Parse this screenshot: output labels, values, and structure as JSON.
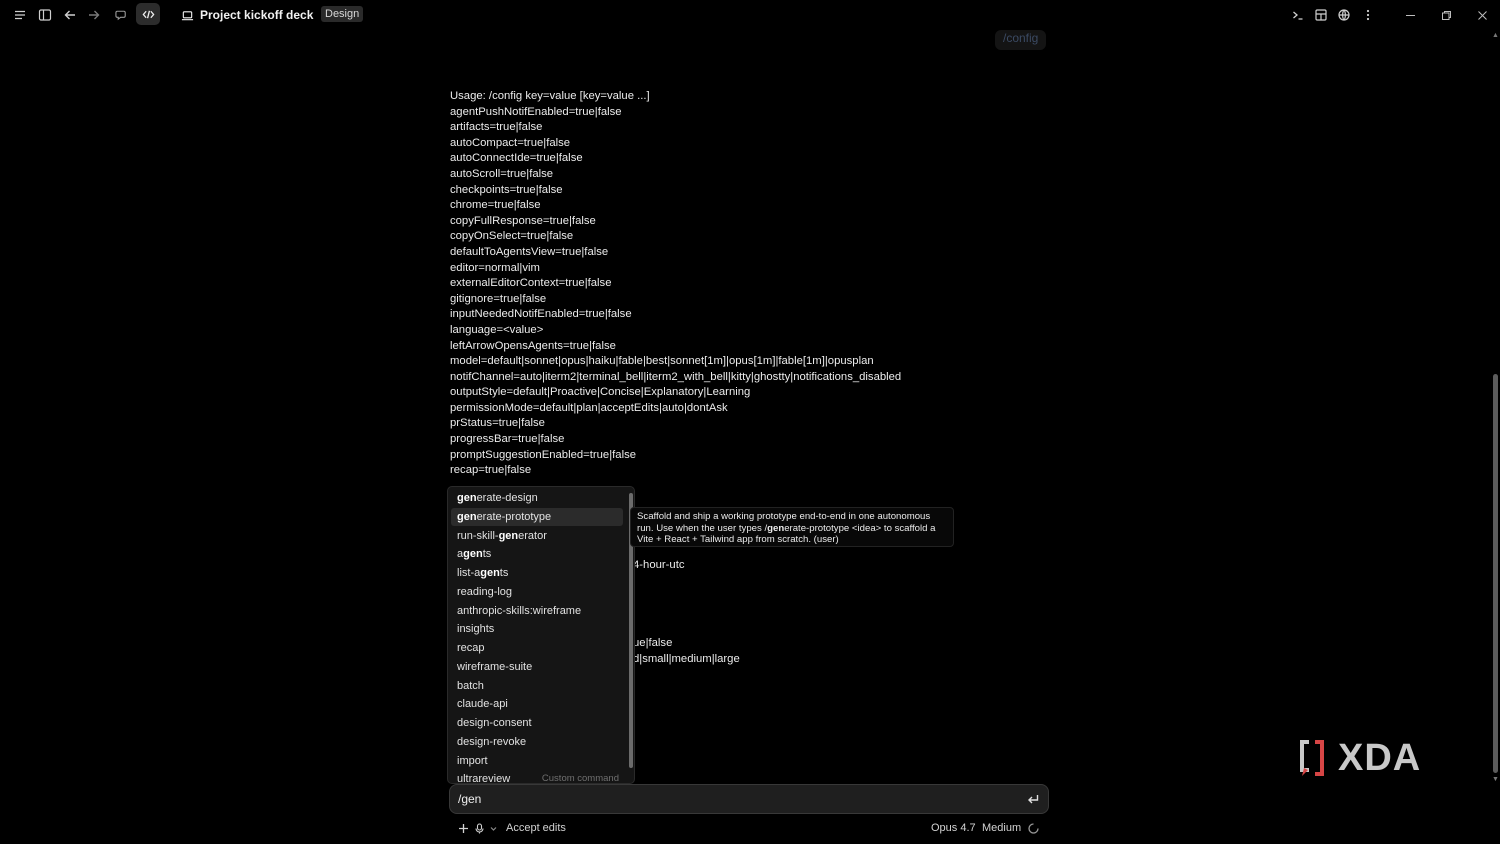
{
  "topbar": {
    "project_title": "Project kickoff deck",
    "badge": "Design"
  },
  "history": {
    "user_command": "/config"
  },
  "output": {
    "lines": [
      "Usage: /config key=value [key=value ...]",
      "agentPushNotifEnabled=true|false",
      "artifacts=true|false",
      "autoCompact=true|false",
      "autoConnectIde=true|false",
      "autoScroll=true|false",
      "checkpoints=true|false",
      "chrome=true|false",
      "copyFullResponse=true|false",
      "copyOnSelect=true|false",
      "defaultToAgentsView=true|false",
      "editor=normal|vim",
      "externalEditorContext=true|false",
      "gitignore=true|false",
      "inputNeededNotifEnabled=true|false",
      "language=<value>",
      "leftArrowOpensAgents=true|false",
      "model=default|sonnet|opus|haiku|fable|best|sonnet[1m]|opus[1m]|fable[1m]|opusplan",
      "notifChannel=auto|iterm2|terminal_bell|iterm2_with_bell|kitty|ghostty|notifications_disabled",
      "outputStyle=default|Proactive|Concise|Explanatory|Learning",
      "permissionMode=default|plan|acceptEdits|auto|dontAsk",
      "prStatus=true|false",
      "progressBar=true|false",
      "promptSuggestionEnabled=true|false",
      "recap=true|false"
    ],
    "hidden_fragments": [
      "4-hour-utc",
      "ue|false",
      "d|small|medium|large"
    ]
  },
  "autocomplete": {
    "items": [
      {
        "match": "gen",
        "rest": "erate-design",
        "selected": false
      },
      {
        "match": "gen",
        "rest": "erate-prototype",
        "selected": true
      },
      {
        "pre": "run-skill-",
        "match": "gen",
        "rest": "erator",
        "selected": false
      },
      {
        "pre": "a",
        "match": "gen",
        "rest": "ts",
        "selected": false
      },
      {
        "pre": "list-a",
        "match": "gen",
        "rest": "ts",
        "selected": false
      },
      {
        "pre": "reading-log",
        "selected": false
      },
      {
        "pre": "anthropic-skills:wireframe",
        "selected": false
      },
      {
        "pre": "insights",
        "selected": false
      },
      {
        "pre": "recap",
        "selected": false
      },
      {
        "pre": "wireframe-suite",
        "selected": false
      },
      {
        "pre": "batch",
        "selected": false
      },
      {
        "pre": "claude-api",
        "selected": false
      },
      {
        "pre": "design-consent",
        "selected": false
      },
      {
        "pre": "design-revoke",
        "selected": false
      },
      {
        "pre": "import",
        "selected": false
      },
      {
        "pre": "ultrareview",
        "selected": false,
        "tag": "Custom command"
      }
    ]
  },
  "tooltip": {
    "text_before": "Scaffold and ship a working prototype end-to-end in one autonomous run. Use when the user types /",
    "text_bold": "gen",
    "text_after": "erate-prototype <idea> to scaffold a Vite + React + Tailwind app from scratch. (user)"
  },
  "input": {
    "value": "/gen"
  },
  "toolbar": {
    "accept_edits": "Accept edits",
    "model": "Opus 4.7",
    "effort": "Medium"
  },
  "watermark": {
    "text": "XDA"
  },
  "colors": {
    "background": "#000000",
    "text": "#ececec",
    "popup_bg": "#151515",
    "selected_bg": "#2b2b2b",
    "input_bg": "#1f1f1f",
    "watermark_accent": "#d64545"
  }
}
